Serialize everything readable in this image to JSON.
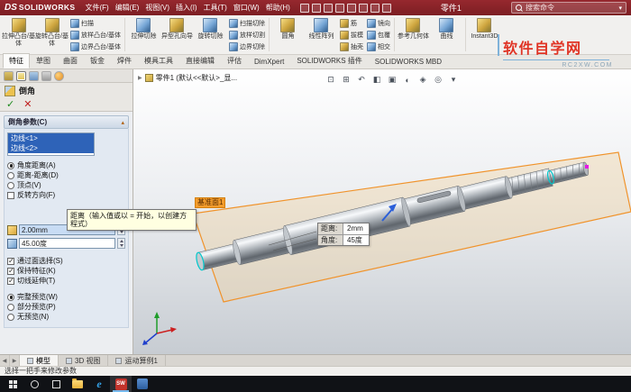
{
  "titlebar": {
    "logo_ds": "DS",
    "logo_text": "SOLIDWORKS",
    "menus": [
      "文件(F)",
      "编辑(E)",
      "视图(V)",
      "插入(I)",
      "工具(T)",
      "窗口(W)",
      "帮助(H)"
    ],
    "doc_title": "零件1",
    "search_placeholder": "搜索命令"
  },
  "ribbon": {
    "large": [
      "拉伸凸台/基体",
      "旋转凸台/基体",
      "拉伸切除",
      "异型孔向导",
      "旋转切除",
      "圆角",
      "线性阵列",
      "参考几何体",
      "曲线",
      "Instant3D"
    ],
    "small_a": [
      "扫描",
      "放样凸台/基体",
      "边界凸台/基体"
    ],
    "small_b": [
      "扫描切除",
      "放样切割",
      "边界切除"
    ],
    "small_c": [
      "筋",
      "拔模",
      "抽壳"
    ],
    "small_d": [
      "镜向",
      "包覆",
      "相交"
    ]
  },
  "cmd_tabs": [
    "特征",
    "草图",
    "曲面",
    "钣金",
    "焊件",
    "模具工具",
    "直接编辑",
    "评估",
    "DimXpert",
    "SOLIDWORKS 插件",
    "SOLIDWORKS MBD"
  ],
  "panel": {
    "title": "倒角",
    "group_header": "倒角参数(C)",
    "edges": [
      "边线<1>",
      "边线<2>"
    ],
    "radios_method": [
      "角度距离(A)",
      "距离-距离(D)",
      "顶点(V)"
    ],
    "check_flip": "反转方向(F)",
    "tooltip": "距离（输入值或以 = 开始，以创建方程式）",
    "distance_value": "2.00mm",
    "angle_value": "45.00度",
    "checks": [
      "通过面选择(S)",
      "保持特征(K)",
      "切线延伸(T)"
    ],
    "radios_preview": [
      "完整预览(W)",
      "部分预览(P)",
      "无预览(N)"
    ]
  },
  "viewport": {
    "tree_label": "零件1 (默认<<默认>_显...",
    "plane_label": "基准面1",
    "callout": {
      "distance_label": "距离:",
      "distance_value": "2mm",
      "angle_label": "角度:",
      "angle_value": "45度"
    }
  },
  "watermark": {
    "title": "软件自学网",
    "url": "RC2XW.COM"
  },
  "doc_tabs": [
    "模型",
    "3D 视图",
    "运动算例1"
  ],
  "statusbar": "选择一把手来修改参数",
  "taskbar": {
    "sw_label": "SW",
    "edge_label": "e"
  },
  "glyphs": {
    "ok": "✓",
    "cancel": "✕",
    "chevron_up": "▴",
    "tree_expand": "▶",
    "search_caret": "▾",
    "nav_left": "◀",
    "nav_right": "▶",
    "vtb": [
      "⊡",
      "⊞",
      "↶",
      "◧",
      "▣",
      "◐",
      "◈",
      "◎",
      "▾"
    ]
  },
  "colors": {
    "titlebar": "#87232a",
    "selection": "#2e63b8",
    "plane_border": "#f0932b",
    "watermark_red": "#e03425"
  }
}
